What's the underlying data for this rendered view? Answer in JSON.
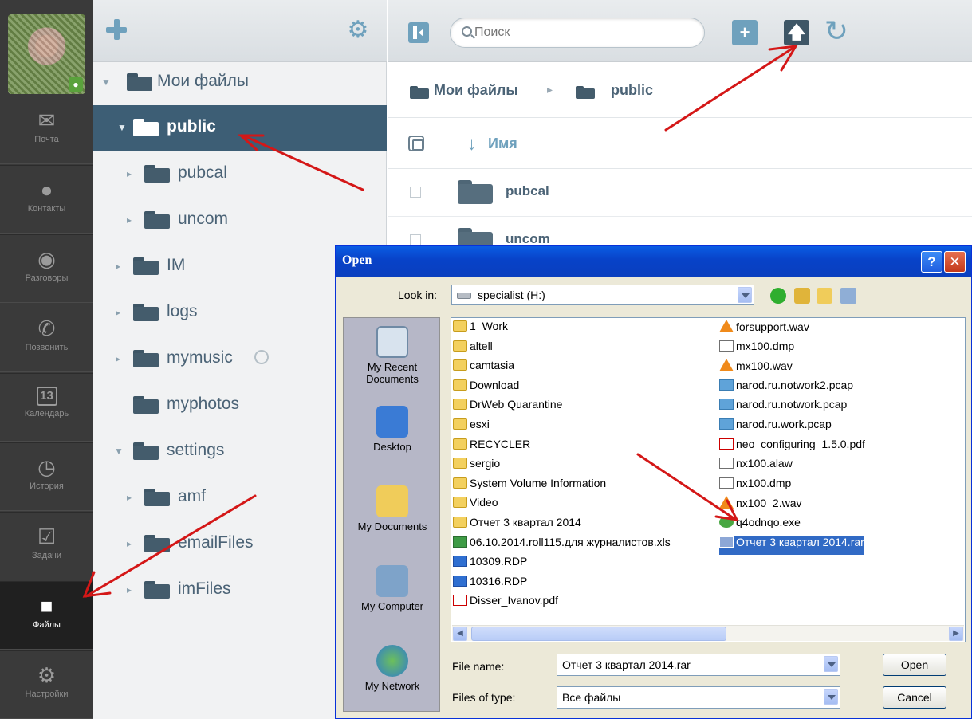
{
  "rail": {
    "items": [
      {
        "label": "Почта",
        "icon": "mail-icon"
      },
      {
        "label": "Контакты",
        "icon": "contacts-icon"
      },
      {
        "label": "Разговоры",
        "icon": "chat-icon"
      },
      {
        "label": "Позвонить",
        "icon": "phone-icon"
      },
      {
        "label": "Календарь",
        "icon": "calendar-icon",
        "badge": "13"
      },
      {
        "label": "История",
        "icon": "history-icon"
      },
      {
        "label": "Задачи",
        "icon": "tasks-icon"
      },
      {
        "label": "Файлы",
        "icon": "folder-icon",
        "active": true
      },
      {
        "label": "Настройки",
        "icon": "settings-icon"
      }
    ]
  },
  "tree": {
    "items": [
      {
        "label": "Мои файлы",
        "expanded": true
      },
      {
        "label": "public",
        "expanded": true,
        "selected": true
      },
      {
        "label": "pubcal"
      },
      {
        "label": "uncom"
      },
      {
        "label": "IM"
      },
      {
        "label": "logs"
      },
      {
        "label": "mymusic",
        "shared": true
      },
      {
        "label": "myphotos"
      },
      {
        "label": "settings",
        "expanded": true
      },
      {
        "label": "amf"
      },
      {
        "label": "emailFiles"
      },
      {
        "label": "imFiles"
      }
    ]
  },
  "main": {
    "search": {
      "placeholder": "Поиск"
    },
    "breadcrumb": [
      "Мои файлы",
      "public"
    ],
    "column_name": "Имя",
    "files": [
      "pubcal",
      "uncom"
    ]
  },
  "dialog": {
    "title": "Open",
    "look_in_label": "Look in:",
    "look_in_value": "specialist (H:)",
    "places": [
      "My Recent Documents",
      "Desktop",
      "My Documents",
      "My Computer",
      "My Network"
    ],
    "files_col1": [
      {
        "name": "1_Work",
        "type": "folder"
      },
      {
        "name": "altell",
        "type": "folder"
      },
      {
        "name": "camtasia",
        "type": "folder"
      },
      {
        "name": "Download",
        "type": "folder"
      },
      {
        "name": "DrWeb Quarantine",
        "type": "folder"
      },
      {
        "name": "esxi",
        "type": "folder"
      },
      {
        "name": "RECYCLER",
        "type": "folder"
      },
      {
        "name": "sergio",
        "type": "folder"
      },
      {
        "name": "System Volume Information",
        "type": "folder"
      },
      {
        "name": "Video",
        "type": "folder"
      },
      {
        "name": "Отчет 3 квартал 2014",
        "type": "folder"
      },
      {
        "name": "06.10.2014.roll115.для журналистов.xls",
        "type": "xls"
      },
      {
        "name": "10309.RDP",
        "type": "rdp"
      },
      {
        "name": "10316.RDP",
        "type": "rdp"
      },
      {
        "name": "Disser_Ivanov.pdf",
        "type": "pdf"
      }
    ],
    "files_col2": [
      {
        "name": "forsupport.wav",
        "type": "vlc"
      },
      {
        "name": "mx100.dmp",
        "type": "file"
      },
      {
        "name": "mx100.wav",
        "type": "vlc"
      },
      {
        "name": "narod.ru.notwork2.pcap",
        "type": "pcap"
      },
      {
        "name": "narod.ru.notwork.pcap",
        "type": "pcap"
      },
      {
        "name": "narod.ru.work.pcap",
        "type": "pcap"
      },
      {
        "name": "neo_configuring_1.5.0.pdf",
        "type": "pdf"
      },
      {
        "name": "nx100.alaw",
        "type": "file"
      },
      {
        "name": "nx100.dmp",
        "type": "file"
      },
      {
        "name": "nx100_2.wav",
        "type": "vlc"
      },
      {
        "name": "q4odnqo.exe",
        "type": "exe"
      },
      {
        "name": "Отчет 3 квартал 2014.rar",
        "type": "rar",
        "selected": true
      }
    ],
    "file_name_label": "File name:",
    "file_name_value": "Отчет 3 квартал 2014.rar",
    "file_type_label": "Files of type:",
    "file_type_value": "Все файлы",
    "open_button": "Open",
    "cancel_button": "Cancel"
  }
}
